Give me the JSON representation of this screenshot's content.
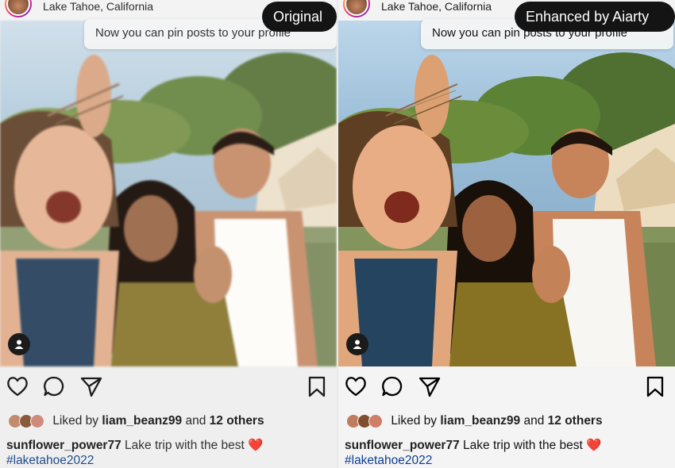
{
  "panels": [
    {
      "badge": "Original",
      "location": "Lake Tahoe, California",
      "tooltip": "Now you can pin posts to your profile",
      "liked_by_prefix": "Liked by",
      "liked_by_user": "liam_beanz99",
      "liked_by_and": "and",
      "liked_by_others": "12 others",
      "caption_user": "sunflower_power77",
      "caption_text": "Lake trip with the best",
      "caption_emoji": "❤️",
      "hashtag": "#laketahoe2022"
    },
    {
      "badge": "Enhanced by Aiarty",
      "location": "Lake Tahoe, California",
      "tooltip": "Now you can pin posts to your profile",
      "liked_by_prefix": "Liked by",
      "liked_by_user": "liam_beanz99",
      "liked_by_and": "and",
      "liked_by_others": "12 others",
      "caption_user": "sunflower_power77",
      "caption_text": "Lake trip with the best",
      "caption_emoji": "❤️",
      "hashtag": "#laketahoe2022"
    }
  ],
  "icons": [
    "heart-icon",
    "comment-icon",
    "share-icon",
    "bookmark-icon",
    "user-tag-icon"
  ],
  "colors": {
    "badge_bg": "#141414",
    "hashtag": "#1f4b8a",
    "heart": "#e0202a"
  }
}
